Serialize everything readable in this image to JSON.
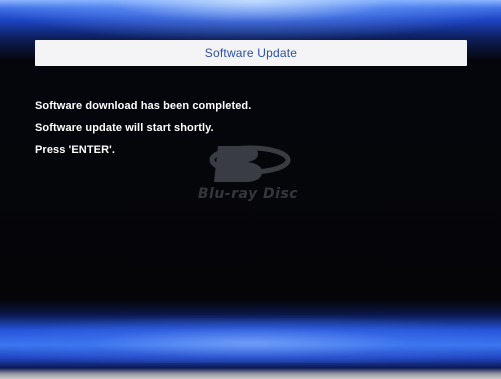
{
  "dialog": {
    "title": "Software Update",
    "lines": [
      "Software download has been completed.",
      "Software update will start shortly.",
      "Press 'ENTER'."
    ]
  },
  "background_logo": {
    "icon": "blu-ray-disc-logo",
    "text": "Blu-ray Disc"
  },
  "colors": {
    "title_text": "#2c4fa8",
    "title_bar": "#f4f4f6",
    "message_text": "#ffffff",
    "accent_blue": "#2553d8"
  }
}
